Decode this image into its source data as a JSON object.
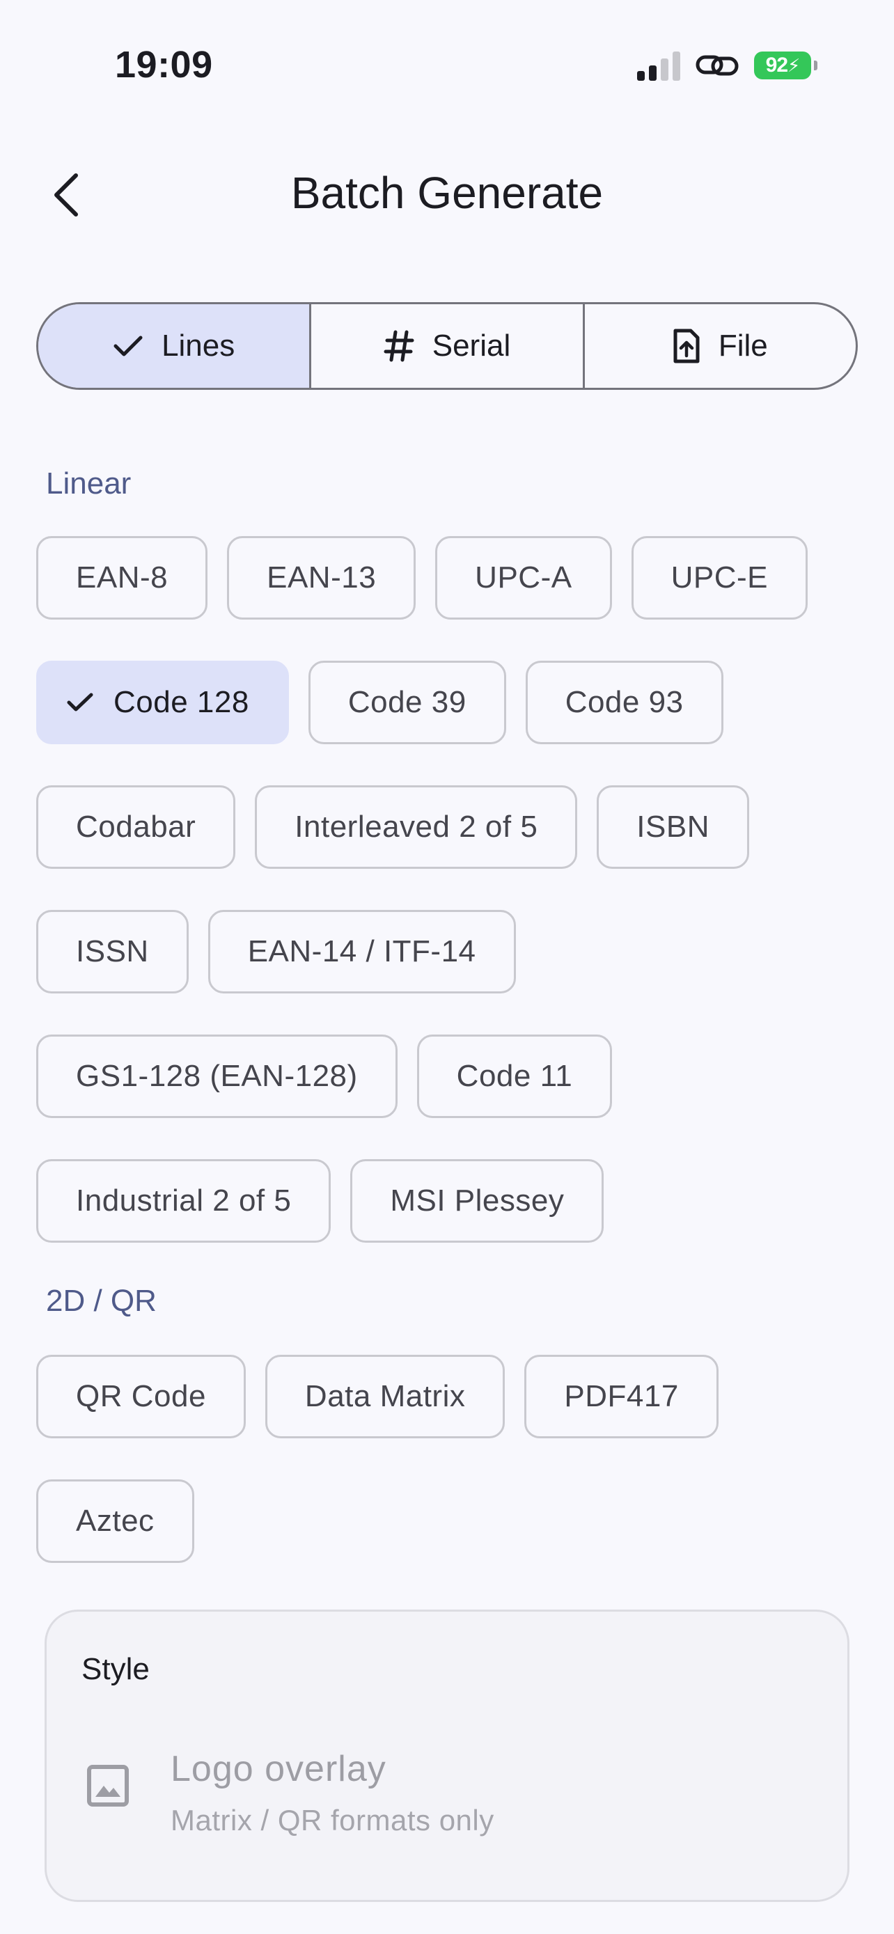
{
  "status_bar": {
    "time": "19:09",
    "battery": "92"
  },
  "header": {
    "title": "Batch Generate"
  },
  "segments": [
    {
      "label": "Lines",
      "icon": "check-icon",
      "selected": true
    },
    {
      "label": "Serial",
      "icon": "hash-icon",
      "selected": false
    },
    {
      "label": "File",
      "icon": "file-upload-icon",
      "selected": false
    }
  ],
  "sections": {
    "linear": {
      "label": "Linear",
      "chips": [
        "EAN-8",
        "EAN-13",
        "UPC-A",
        "UPC-E",
        "Code 128",
        "Code 39",
        "Code 93",
        "Codabar",
        "Interleaved 2 of 5",
        "ISBN",
        "ISSN",
        "EAN-14 / ITF-14",
        "GS1-128 (EAN-128)",
        "Code 11",
        "Industrial 2 of 5",
        "MSI Plessey"
      ],
      "selected": "Code 128"
    },
    "matrix": {
      "label": "2D / QR",
      "chips": [
        "QR Code",
        "Data Matrix",
        "PDF417",
        "Aztec"
      ]
    }
  },
  "style": {
    "title": "Style",
    "logo_overlay": {
      "title": "Logo overlay",
      "subtitle": "Matrix / QR formats only",
      "icon": "image-icon",
      "enabled": false
    }
  },
  "colors": {
    "accent_bg": "#dde1f9",
    "section_label": "#4f5a8a",
    "battery": "#34c759"
  }
}
